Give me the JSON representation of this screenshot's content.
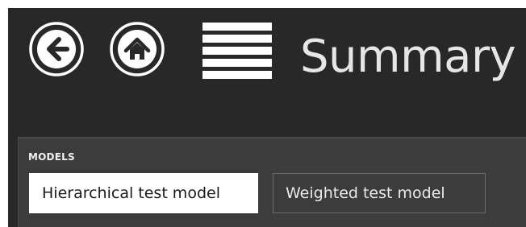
{
  "header": {
    "title": "Summary",
    "back_button": {
      "icon": "back-arrow-icon"
    },
    "home_button": {
      "icon": "home-icon"
    },
    "menu_button": {
      "icon": "hamburger-menu-icon"
    }
  },
  "models": {
    "section_label": "MODELS",
    "items": [
      {
        "label": "Hierarchical test model",
        "selected": true
      },
      {
        "label": "Weighted test model",
        "selected": false
      }
    ]
  },
  "colors": {
    "background": "#282828",
    "panel": "#3c3c3c",
    "foreground": "#ffffff",
    "selected_bg": "#ffffff",
    "selected_text": "#1a1a1a"
  }
}
